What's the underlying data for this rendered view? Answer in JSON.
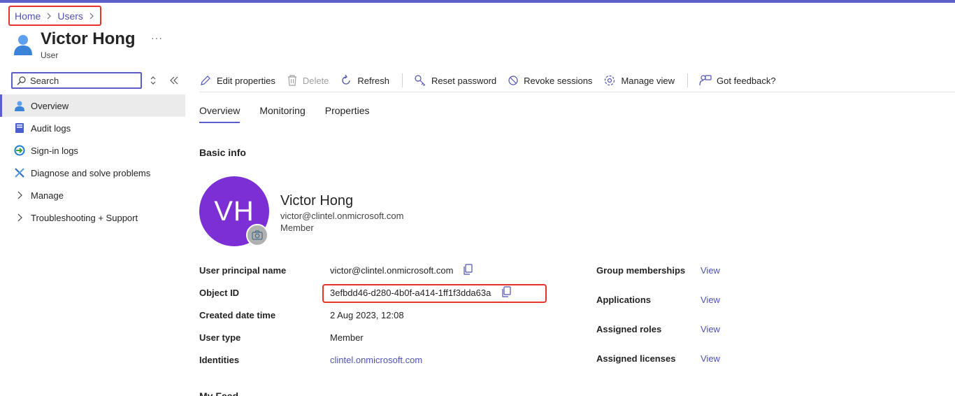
{
  "breadcrumb": {
    "home": "Home",
    "users": "Users"
  },
  "header": {
    "title": "Victor Hong",
    "subtitle": "User",
    "more": "···"
  },
  "search": {
    "placeholder": "Search"
  },
  "sidebar": {
    "items": [
      {
        "label": "Overview",
        "icon": "user-icon"
      },
      {
        "label": "Audit logs",
        "icon": "audit-log-icon"
      },
      {
        "label": "Sign-in logs",
        "icon": "sign-in-icon"
      },
      {
        "label": "Diagnose and solve problems",
        "icon": "wrench-icon"
      },
      {
        "label": "Manage",
        "icon": "chevron-right-icon"
      },
      {
        "label": "Troubleshooting + Support",
        "icon": "chevron-right-icon"
      }
    ]
  },
  "toolbar": {
    "edit": "Edit properties",
    "delete": "Delete",
    "refresh": "Refresh",
    "reset_password": "Reset password",
    "revoke_sessions": "Revoke sessions",
    "manage_view": "Manage view",
    "feedback": "Got feedback?"
  },
  "tabs": {
    "overview": "Overview",
    "monitoring": "Monitoring",
    "properties": "Properties"
  },
  "basic_info": {
    "heading": "Basic info",
    "initials": "VH",
    "name": "Victor Hong",
    "email": "victor@clintel.onmicrosoft.com",
    "member_type": "Member"
  },
  "properties": {
    "upn_label": "User principal name",
    "upn_value": "victor@clintel.onmicrosoft.com",
    "object_id_label": "Object ID",
    "object_id_value": "3efbdd46-d280-4b0f-a414-1ff1f3dda63a",
    "created_label": "Created date time",
    "created_value": "2 Aug 2023, 12:08",
    "user_type_label": "User type",
    "user_type_value": "Member",
    "identities_label": "Identities",
    "identities_value": "clintel.onmicrosoft.com"
  },
  "links": {
    "group_label": "Group memberships",
    "applications_label": "Applications",
    "roles_label": "Assigned roles",
    "licenses_label": "Assigned licenses",
    "view": "View"
  },
  "feed": {
    "heading": "My Feed"
  },
  "colors": {
    "accent": "#5b5fc7",
    "avatar": "#7b2fd4",
    "highlight": "#e8322c",
    "link": "#4f52b2"
  }
}
